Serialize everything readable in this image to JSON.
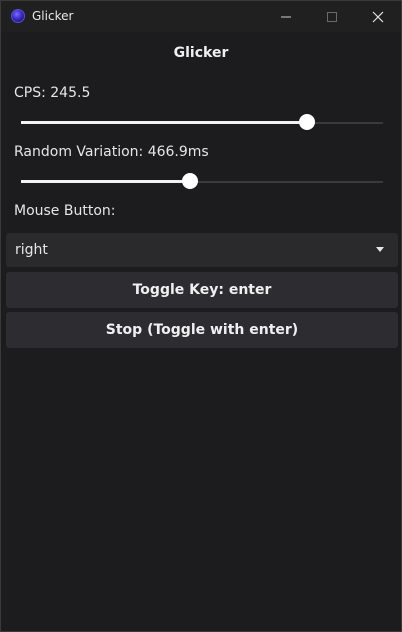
{
  "window": {
    "title": "Glicker",
    "icon": "app-logo-icon",
    "controls": [
      "minimize-icon",
      "maximize-icon",
      "close-icon"
    ]
  },
  "app": {
    "heading": "Glicker",
    "cps": {
      "label": "CPS: 245.5",
      "fraction": 0.79
    },
    "random_variation": {
      "label": "Random Variation: 466.9ms",
      "fraction": 0.467
    },
    "mouse_button": {
      "label": "Mouse Button:",
      "selected": "right"
    },
    "toggle_key_button": "Toggle Key: enter",
    "stop_button": "Stop (Toggle with enter)"
  },
  "colors": {
    "background": "#1c1c1e",
    "titlebar": "#202020",
    "control": "#2d2d31",
    "slider_fill": "#f2f2f2",
    "text": "#e6e6e6"
  }
}
